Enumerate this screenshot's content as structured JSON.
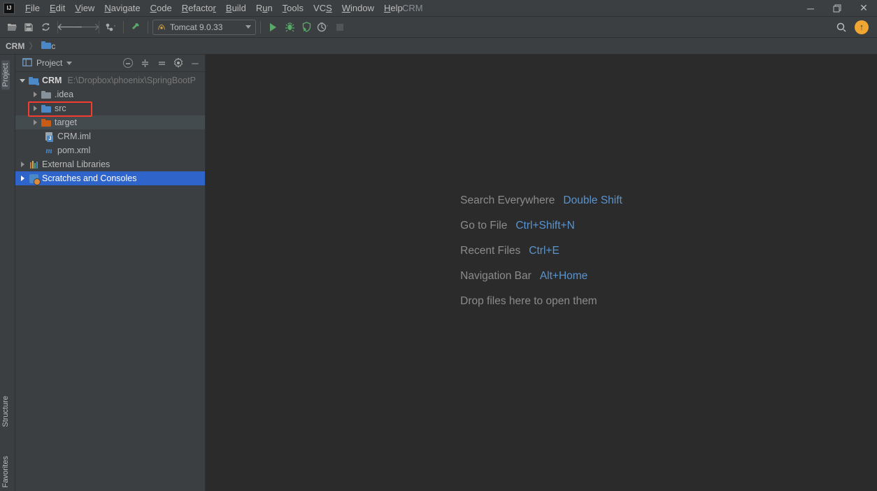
{
  "app": {
    "title": "CRM"
  },
  "menu": {
    "items": [
      {
        "label": "File",
        "mn": "F"
      },
      {
        "label": "Edit",
        "mn": "E"
      },
      {
        "label": "View",
        "mn": "V"
      },
      {
        "label": "Navigate",
        "mn": "N"
      },
      {
        "label": "Code",
        "mn": "C"
      },
      {
        "label": "Refactor",
        "mn": "R"
      },
      {
        "label": "Build",
        "mn": "B"
      },
      {
        "label": "Run",
        "mn": "u"
      },
      {
        "label": "Tools",
        "mn": "T"
      },
      {
        "label": "VCS",
        "mn": "S"
      },
      {
        "label": "Window",
        "mn": "W"
      },
      {
        "label": "Help",
        "mn": "H"
      }
    ]
  },
  "toolbar": {
    "run_config": "Tomcat 9.0.33"
  },
  "breadcrumb": {
    "root": "CRM",
    "folder": "src"
  },
  "sidebar": {
    "project": "Project",
    "structure": "Structure",
    "favorites": "Favorites"
  },
  "project_header": {
    "label": "Project"
  },
  "tree": {
    "root": {
      "name": "CRM",
      "location": "E:\\Dropbox\\phoenix\\SpringBootP"
    },
    "idea": ".idea",
    "src": "src",
    "target": "target",
    "iml": "CRM.iml",
    "pom": "pom.xml",
    "extlib": "External Libraries",
    "scratch": "Scratches and Consoles"
  },
  "tips": [
    {
      "label": "Search Everywhere",
      "key": "Double Shift"
    },
    {
      "label": "Go to File",
      "key": "Ctrl+Shift+N"
    },
    {
      "label": "Recent Files",
      "key": "Ctrl+E"
    },
    {
      "label": "Navigation Bar",
      "key": "Alt+Home"
    },
    {
      "label": "Drop files here to open them",
      "key": ""
    }
  ]
}
